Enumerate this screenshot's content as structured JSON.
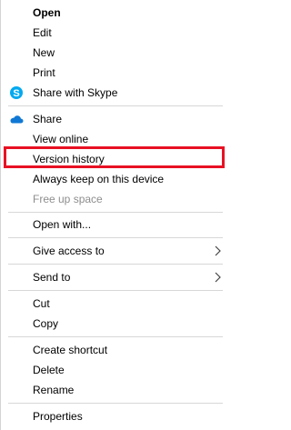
{
  "context_menu": {
    "items": [
      {
        "label": "Open"
      },
      {
        "label": "Edit"
      },
      {
        "label": "New"
      },
      {
        "label": "Print"
      },
      {
        "label": "Share with Skype",
        "icon": "skype-icon"
      },
      {
        "label": "Share",
        "icon": "onedrive-cloud-icon"
      },
      {
        "label": "View online"
      },
      {
        "label": "Version history"
      },
      {
        "label": "Always keep on this device"
      },
      {
        "label": "Free up space"
      },
      {
        "label": "Open with..."
      },
      {
        "label": "Give access to",
        "icon": "chevron-right-icon"
      },
      {
        "label": "Send to",
        "icon": "chevron-right-icon"
      },
      {
        "label": "Cut"
      },
      {
        "label": "Copy"
      },
      {
        "label": "Create shortcut"
      },
      {
        "label": "Delete"
      },
      {
        "label": "Rename"
      },
      {
        "label": "Properties"
      }
    ]
  },
  "colors": {
    "highlight_border": "#e81123",
    "skype_blue": "#00a9f0",
    "onedrive_blue": "#0f78d4",
    "separator": "#d7d7d7",
    "disabled_text": "#8e8e8e"
  }
}
